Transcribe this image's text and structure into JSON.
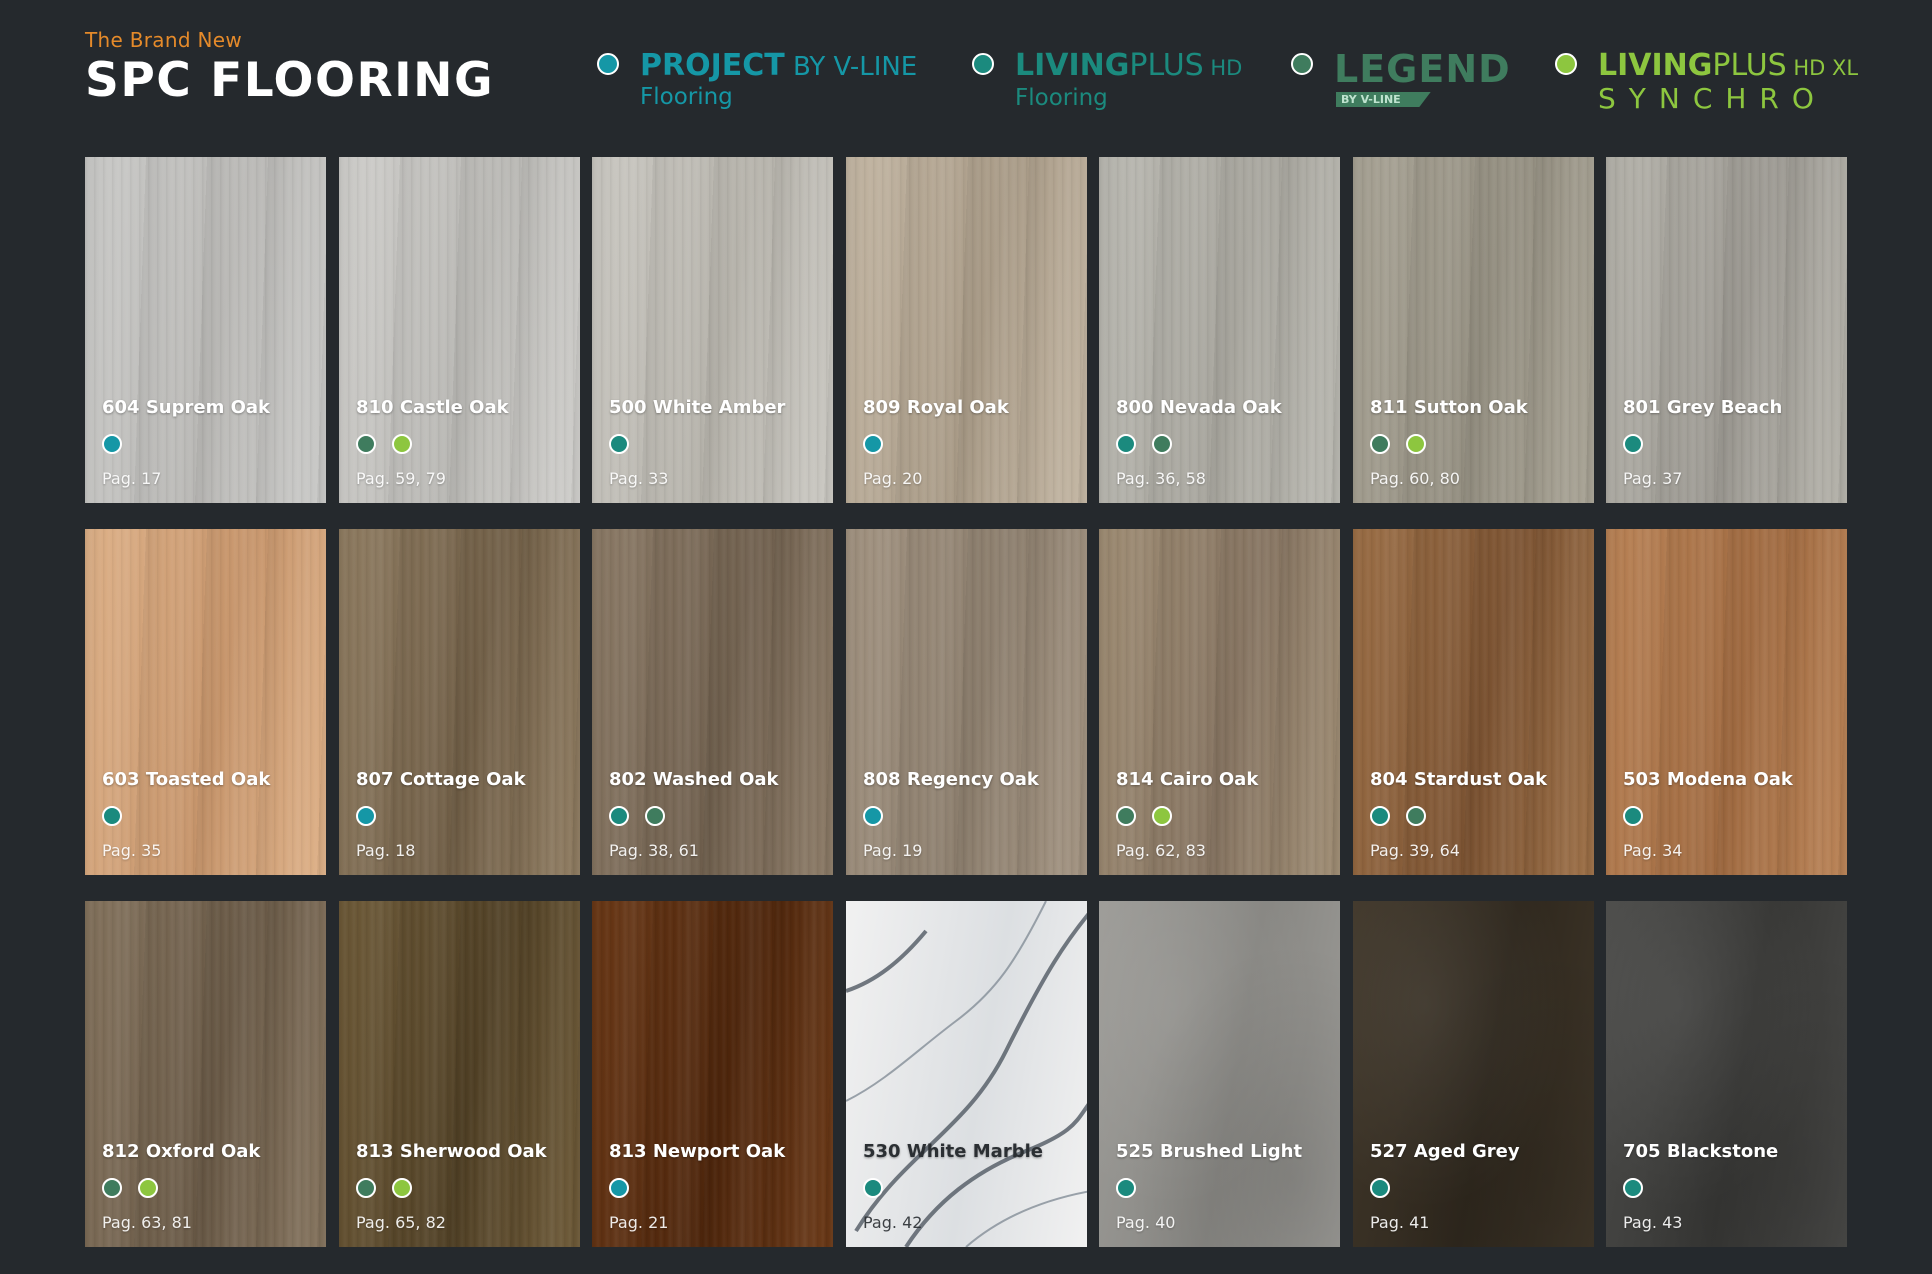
{
  "header": {
    "subtitle": "The Brand New",
    "title": "SPC FLOORING"
  },
  "colors": {
    "background": "#25292d",
    "accent_orange": "#e58a2a",
    "project": "#1597a6",
    "livingplus_hd": "#1b8a7e",
    "legend": "#3f7c5e",
    "livingplus_xl": "#8dc63f"
  },
  "legend": [
    {
      "key": "project",
      "color": "#1597a6",
      "line1_bold": "PROJECT",
      "line1_thin": " BY V-LINE",
      "line2": "Flooring"
    },
    {
      "key": "livingplus_hd",
      "color": "#1b8a7e",
      "line1_bold": "LIVING",
      "line1_thin": "PLUS",
      "line1_small": " HD",
      "line2": "Flooring"
    },
    {
      "key": "legend",
      "color": "#3f7c5e",
      "line1_bold": "LEGEND",
      "badge": "BY V-LINE"
    },
    {
      "key": "livingplus_xl",
      "color": "#8dc63f",
      "line1_bold": "LIVING",
      "line1_thin": "PLUS",
      "line1_small": " HD XL",
      "line2": "SYNCHRO"
    }
  ],
  "products": [
    {
      "name": "604 Suprem Oak",
      "page": "Pag. 17",
      "dots": [
        "#1597a6"
      ],
      "swatch": [
        "#c9c9c7",
        "#b9b8b5"
      ]
    },
    {
      "name": "810 Castle Oak",
      "page": "Pag. 59, 79",
      "dots": [
        "#3f7c5e",
        "#8dc63f"
      ],
      "swatch": [
        "#cfcecb",
        "#b8b7b3"
      ]
    },
    {
      "name": "500 White Amber",
      "page": "Pag. 33",
      "dots": [
        "#1b8a7e"
      ],
      "swatch": [
        "#cac8c2",
        "#b5b2aa"
      ]
    },
    {
      "name": "809 Royal Oak",
      "page": "Pag. 20",
      "dots": [
        "#1597a6"
      ],
      "swatch": [
        "#c3b6a3",
        "#a89a86"
      ]
    },
    {
      "name": "800 Nevada Oak",
      "page": "Pag. 36, 58",
      "dots": [
        "#1b8a7e",
        "#3f7c5e"
      ],
      "swatch": [
        "#b9b8b1",
        "#a7a59d"
      ]
    },
    {
      "name": "811 Sutton Oak",
      "page": "Pag. 60, 80",
      "dots": [
        "#3f7c5e",
        "#8dc63f"
      ],
      "swatch": [
        "#a8a395",
        "#938e80"
      ]
    },
    {
      "name": "801 Grey Beach",
      "page": "Pag. 37",
      "dots": [
        "#1b8a7e"
      ],
      "swatch": [
        "#b4b2aa",
        "#9b9891"
      ]
    },
    {
      "name": "603 Toasted Oak",
      "page": "Pag. 35",
      "dots": [
        "#1b8a7e"
      ],
      "swatch": [
        "#deb188",
        "#c6946a"
      ]
    },
    {
      "name": "807 Cottage Oak",
      "page": "Pag. 18",
      "dots": [
        "#1597a6"
      ],
      "swatch": [
        "#8f7c61",
        "#6f5d45"
      ]
    },
    {
      "name": "802 Washed Oak",
      "page": "Pag. 38, 61",
      "dots": [
        "#1b8a7e",
        "#3f7c5e"
      ],
      "swatch": [
        "#8b7a66",
        "#6f5f4d"
      ]
    },
    {
      "name": "808 Regency Oak",
      "page": "Pag. 19",
      "dots": [
        "#1597a6"
      ],
      "swatch": [
        "#a29381",
        "#8b7d6c"
      ]
    },
    {
      "name": "814 Cairo Oak",
      "page": "Pag. 62, 83",
      "dots": [
        "#3f7c5e",
        "#8dc63f"
      ],
      "swatch": [
        "#9e8c73",
        "#857360"
      ]
    },
    {
      "name": "804 Stardust Oak",
      "page": "Pag. 39, 64",
      "dots": [
        "#1b8a7e",
        "#3f7c5e"
      ],
      "swatch": [
        "#9c6f46",
        "#7b5231"
      ]
    },
    {
      "name": "503 Modena Oak",
      "page": "Pag. 34",
      "dots": [
        "#1b8a7e"
      ],
      "swatch": [
        "#b98255",
        "#a06a40"
      ]
    },
    {
      "name": "812 Oxford Oak",
      "page": "Pag. 63, 81",
      "dots": [
        "#3f7c5e",
        "#8dc63f"
      ],
      "swatch": [
        "#84735d",
        "#685845"
      ]
    },
    {
      "name": "813 Sherwood Oak",
      "page": "Pag. 65, 82",
      "dots": [
        "#3f7c5e",
        "#8dc63f"
      ],
      "swatch": [
        "#6e5a38",
        "#4f3f24"
      ]
    },
    {
      "name": "813 Newport Oak",
      "page": "Pag. 21",
      "dots": [
        "#1597a6"
      ],
      "swatch": [
        "#6a3816",
        "#4d250b"
      ]
    },
    {
      "name": "530 White Marble",
      "page": "Pag. 42",
      "dots": [
        "#1b8a7e"
      ],
      "swatch": [
        "#f1f1f1",
        "#dcdfe2"
      ]
    },
    {
      "name": "525 Brushed Light",
      "page": "Pag. 40",
      "dots": [
        "#1b8a7e"
      ],
      "swatch": [
        "#9c9b97",
        "#878682"
      ]
    },
    {
      "name": "527 Aged Grey",
      "page": "Pag. 41",
      "dots": [
        "#1b8a7e"
      ],
      "swatch": [
        "#3f3629",
        "#2e271d"
      ]
    },
    {
      "name": "705 Blackstone",
      "page": "Pag. 43",
      "dots": [
        "#1b8a7e"
      ],
      "swatch": [
        "#4a4a48",
        "#363634"
      ]
    }
  ]
}
